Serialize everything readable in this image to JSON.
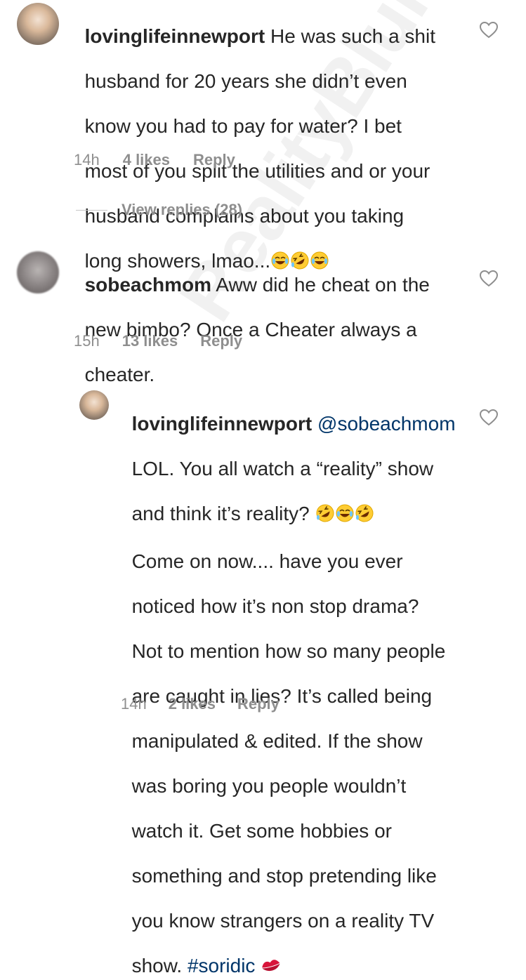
{
  "comments": [
    {
      "username": "lovinglifeinnewport",
      "text": "He was such a shit husband for 20 years she didn't even know you had to pay for water? I bet most of you split the utilities and or your husband complains about you taking long showers, lmao...",
      "lines": [
        "He was such a shit",
        "husband for 20 years she didn’t even",
        "know you had to pay for water? I bet",
        "most of you split the utilities and or your",
        "husband complains about you taking",
        "long showers, lmao..."
      ],
      "emojis": [
        "laughing-tears",
        "rofl",
        "laughing-tears"
      ],
      "time": "14h",
      "likes": "4 likes",
      "reply": "Reply"
    },
    {
      "username": "sobeachmom",
      "lines": [
        "Aww did he cheat on the",
        "new bimbo? Once a Cheater always a",
        "cheater."
      ],
      "time": "15h",
      "likes": "13 likes",
      "reply": "Reply"
    },
    {
      "username": "lovinglifeinnewport",
      "mention": "@sobeachmom",
      "lines": [
        "LOL. You all watch a “reality” show",
        "and think it’s reality?",
        "Come on now.... have you ever",
        "noticed how it’s non stop drama?",
        "Not to mention how so many people",
        "are caught in lies? It’s called being",
        "manipulated & edited. If the show",
        "was boring you people wouldn’t",
        "watch it. Get some hobbies or",
        "something and stop pretending like",
        "you know strangers on a reality TV",
        "show."
      ],
      "hashtag": "#soridic",
      "emojis": [
        "rofl",
        "laughing-tears",
        "rofl"
      ],
      "end_emoji": "kiss-mark",
      "time": "14h",
      "likes": "2 likes",
      "reply": "Reply"
    }
  ],
  "view_replies": "View replies (28)",
  "watermark": {
    "main": "RealityBlurb",
    "accent": "!"
  },
  "colors": {
    "text": "#262626",
    "meta": "#8e8e8e",
    "link": "#003569",
    "heart_stroke": "#8e8e8e",
    "watermark_accent": "#e83c50"
  }
}
